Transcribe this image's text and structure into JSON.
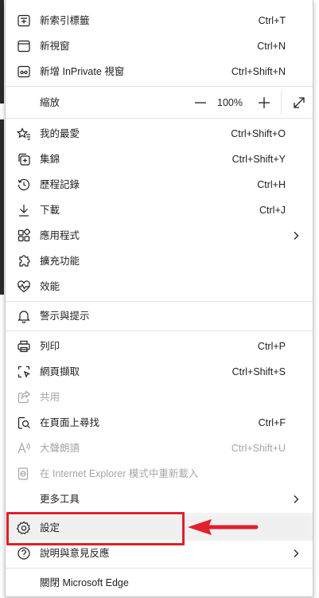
{
  "menu": {
    "items": [
      {
        "key": "new_tab",
        "label": "新索引標籤",
        "shortcut": "Ctrl+T",
        "icon": "new-tab-icon"
      },
      {
        "key": "new_window",
        "label": "新視窗",
        "shortcut": "Ctrl+N",
        "icon": "new-window-icon"
      },
      {
        "key": "new_inprivate",
        "label": "新增 InPrivate 視窗",
        "shortcut": "Ctrl+Shift+N",
        "icon": "inprivate-icon"
      },
      {
        "key": "favorites",
        "label": "我的最愛",
        "shortcut": "Ctrl+Shift+O",
        "icon": "favorites-icon"
      },
      {
        "key": "collections",
        "label": "集錦",
        "shortcut": "Ctrl+Shift+Y",
        "icon": "collections-icon"
      },
      {
        "key": "history",
        "label": "歷程記錄",
        "shortcut": "Ctrl+H",
        "icon": "history-icon"
      },
      {
        "key": "downloads",
        "label": "下載",
        "shortcut": "Ctrl+J",
        "icon": "download-icon"
      },
      {
        "key": "apps",
        "label": "應用程式",
        "shortcut": "",
        "icon": "apps-icon"
      },
      {
        "key": "extensions",
        "label": "擴充功能",
        "shortcut": "",
        "icon": "extensions-icon"
      },
      {
        "key": "performance",
        "label": "效能",
        "shortcut": "",
        "icon": "performance-icon"
      },
      {
        "key": "alerts",
        "label": "警示與提示",
        "shortcut": "",
        "icon": "bell-icon"
      },
      {
        "key": "print",
        "label": "列印",
        "shortcut": "Ctrl+P",
        "icon": "print-icon"
      },
      {
        "key": "web_capture",
        "label": "網頁擷取",
        "shortcut": "Ctrl+Shift+S",
        "icon": "web-capture-icon"
      },
      {
        "key": "share",
        "label": "共用",
        "shortcut": "",
        "icon": "share-icon"
      },
      {
        "key": "find",
        "label": "在頁面上尋找",
        "shortcut": "Ctrl+F",
        "icon": "find-icon"
      },
      {
        "key": "read_aloud",
        "label": "大聲朗讀",
        "shortcut": "Ctrl+Shift+U",
        "icon": "read-aloud-icon"
      },
      {
        "key": "ie_mode",
        "label": "在 Internet Explorer 模式中重新載入",
        "shortcut": "",
        "icon": "ie-mode-icon"
      },
      {
        "key": "more_tools",
        "label": "更多工具",
        "shortcut": "",
        "icon": ""
      },
      {
        "key": "settings",
        "label": "設定",
        "shortcut": "",
        "icon": "settings-icon"
      },
      {
        "key": "help",
        "label": "說明與意見反應",
        "shortcut": "",
        "icon": "help-icon"
      },
      {
        "key": "close_edge",
        "label": "關閉 Microsoft Edge",
        "shortcut": "",
        "icon": ""
      }
    ],
    "zoom": {
      "label": "縮放",
      "value": "100%",
      "minus_icon": "zoom-out-icon",
      "plus_icon": "zoom-in-icon",
      "fullscreen_icon": "fullscreen-icon"
    },
    "disabled": [
      "share",
      "read_aloud",
      "ie_mode"
    ],
    "highlighted": "settings"
  },
  "annotation": {
    "color": "#e0202a",
    "target": "settings"
  }
}
